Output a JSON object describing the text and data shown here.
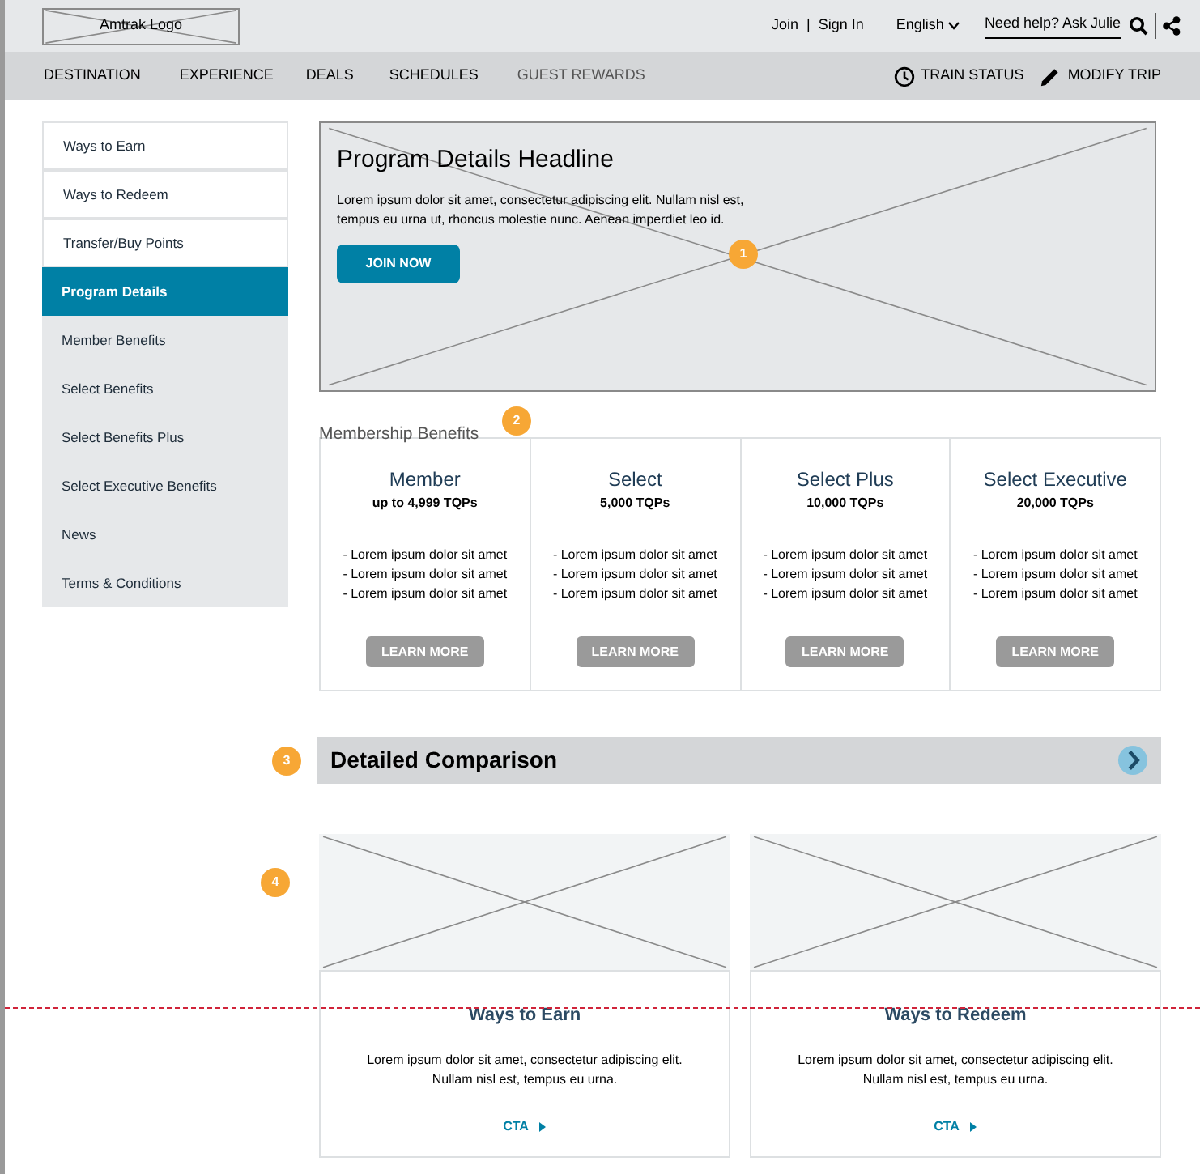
{
  "header": {
    "logo": "Amtrak Logo",
    "join": "Join",
    "separator": "|",
    "sign_in": "Sign In",
    "language": "English",
    "help": "Need help? Ask Julie"
  },
  "nav": {
    "items": [
      {
        "label": "DESTINATION",
        "selected": false
      },
      {
        "label": "EXPERIENCE",
        "selected": false
      },
      {
        "label": "DEALS",
        "selected": false
      },
      {
        "label": "SCHEDULES",
        "selected": false
      },
      {
        "label": "GUEST REWARDS",
        "selected": true
      }
    ],
    "actions": [
      {
        "kind": "clock",
        "label": "TRAIN STATUS"
      },
      {
        "kind": "pencil",
        "label": "MODIFY TRIP"
      }
    ]
  },
  "sidebar": {
    "items": [
      {
        "label": "Ways to Earn",
        "selected": false
      },
      {
        "label": "Ways to Redeem",
        "selected": false
      },
      {
        "label": "Transfer/Buy Points",
        "selected": false
      },
      {
        "label": "Program Details",
        "selected": true,
        "expanded": true,
        "children": [
          {
            "label": "Member Benefits",
            "selected": false
          },
          {
            "label": "Select Benefits",
            "selected": false
          },
          {
            "label": "Select Benefits Plus",
            "selected": false
          },
          {
            "label": "Select Executive Benefits",
            "selected": false
          },
          {
            "label": "News",
            "selected": false
          },
          {
            "label": "Terms & Conditions",
            "selected": false
          }
        ]
      }
    ]
  },
  "hero": {
    "headline": "Program Details Headline",
    "body": "Lorem ipsum dolor sit amet, consectetur adipiscing elit. Nullam nisl est, tempus eu urna ut, rhoncus molestie nunc. Aenean imperdiet leo id.",
    "button": "JOIN NOW",
    "badge": "1"
  },
  "membership": {
    "title": "Membership Benefits",
    "badge": "2",
    "tiers": [
      {
        "name": "Member",
        "tqps": "up to 4,999 TQPs",
        "bullets": [
          "- Lorem ipsum dolor sit amet",
          "- Lorem ipsum dolor sit amet",
          "- Lorem ipsum dolor sit amet"
        ],
        "button": "LEARN MORE"
      },
      {
        "name": "Select",
        "tqps": "5,000 TQPs",
        "bullets": [
          "- Lorem ipsum dolor sit amet",
          "- Lorem ipsum dolor sit amet",
          "- Lorem ipsum dolor sit amet"
        ],
        "button": "LEARN MORE"
      },
      {
        "name": "Select Plus",
        "tqps": "10,000 TQPs",
        "bullets": [
          "- Lorem ipsum dolor sit amet",
          "- Lorem ipsum dolor sit amet",
          "- Lorem ipsum dolor sit amet"
        ],
        "button": "LEARN MORE"
      },
      {
        "name": "Select Executive",
        "tqps": "20,000 TQPs",
        "bullets": [
          "- Lorem ipsum dolor sit amet",
          "- Lorem ipsum dolor sit amet",
          "- Lorem ipsum dolor sit amet"
        ],
        "button": "LEARN MORE"
      }
    ]
  },
  "comparison": {
    "title": "Detailed Comparison",
    "badge": "3"
  },
  "promos": {
    "badge": "4",
    "cards": [
      {
        "title": "Ways to Earn",
        "body": "Lorem ipsum dolor sit amet, consectetur adipiscing elit. Nullam nisl est, tempus eu urna.",
        "cta": "CTA"
      },
      {
        "title": "Ways to Redeem",
        "body": "Lorem ipsum dolor sit amet, consectetur adipiscing elit. Nullam nisl est, tempus eu urna.",
        "cta": "CTA"
      }
    ]
  }
}
